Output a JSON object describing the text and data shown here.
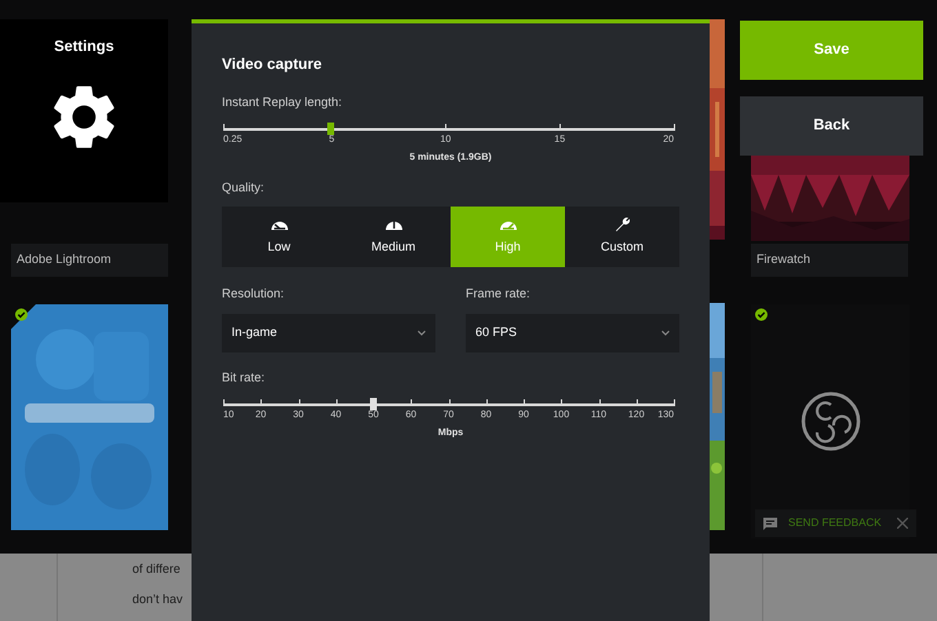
{
  "settings_tile": {
    "title": "Settings"
  },
  "library": [
    {
      "title": "Adobe Lightroom"
    },
    {
      "title": "Firewatch"
    },
    {
      "kind": "picture",
      "checked": true
    },
    {
      "kind": "obs",
      "checked": true
    }
  ],
  "article_lines": [
    "of differe",
    "don’t hav"
  ],
  "dialog": {
    "title": "Video capture",
    "replay": {
      "label": "Instant Replay length:",
      "level": 0.24,
      "ticks": [
        "0.25",
        "5",
        "10",
        "15",
        "20"
      ],
      "reading": "5 minutes (1.9GB)"
    },
    "quality": {
      "label": "Quality:",
      "options": [
        {
          "label": "Low",
          "kind": "low",
          "selected": false
        },
        {
          "label": "Medium",
          "kind": "medium",
          "selected": false
        },
        {
          "label": "High",
          "kind": "high",
          "selected": true
        },
        {
          "label": "Custom",
          "kind": "custom",
          "selected": false
        }
      ]
    },
    "resolution": {
      "label": "Resolution:",
      "value": "In-game"
    },
    "frame_rate": {
      "label": "Frame rate:",
      "value": "60 FPS"
    },
    "bit_rate": {
      "label": "Bit rate:",
      "level": 0.333,
      "ticks": [
        "10",
        "20",
        "30",
        "40",
        "50",
        "60",
        "70",
        "80",
        "90",
        "100",
        "110",
        "120",
        "130"
      ],
      "unit": "Mbps"
    }
  },
  "buttons": [
    {
      "label": "Save",
      "kind": "primary"
    },
    {
      "label": "Back",
      "kind": "secondary"
    }
  ],
  "feedback": {
    "label": "SEND FEEDBACK"
  }
}
